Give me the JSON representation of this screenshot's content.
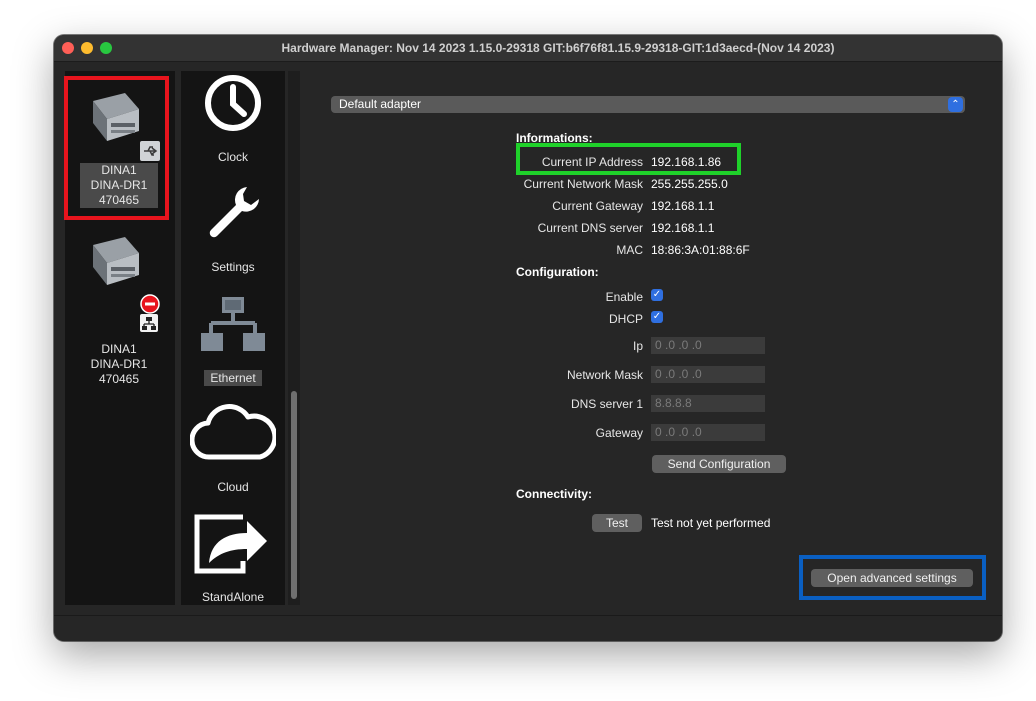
{
  "window": {
    "title": "Hardware Manager: Nov 14 2023 1.15.0-29318 GIT:b6f76f81.15.9-29318-GIT:1d3aecd-(Nov 14 2023)"
  },
  "devices": [
    {
      "name": "DINA1",
      "model": "DINA-DR1",
      "serial": "470465",
      "connection": "usb-icon",
      "selected": true
    },
    {
      "name": "DINA1",
      "model": "DINA-DR1",
      "serial": "470465",
      "connection": "network-icon",
      "status": "error-icon",
      "selected": false
    }
  ],
  "tabs": [
    {
      "label": "Clock",
      "icon": "clock-icon"
    },
    {
      "label": "Settings",
      "icon": "wrench-icon"
    },
    {
      "label": "Ethernet",
      "icon": "network-tree-icon",
      "selected": true
    },
    {
      "label": "Cloud",
      "icon": "cloud-icon"
    },
    {
      "label": "StandAlone",
      "icon": "share-arrow-icon"
    }
  ],
  "adapter": {
    "value": "Default adapter"
  },
  "informations": {
    "heading": "Informations:",
    "rows": [
      {
        "label": "Current IP Address",
        "value": "192.168.1.86"
      },
      {
        "label": "Current Network Mask",
        "value": "255.255.255.0"
      },
      {
        "label": "Current Gateway",
        "value": "192.168.1.1"
      },
      {
        "label": "Current DNS server",
        "value": "192.168.1.1"
      },
      {
        "label": "MAC",
        "value": "18:86:3A:01:88:6F"
      }
    ]
  },
  "configuration": {
    "heading": "Configuration:",
    "enable_label": "Enable",
    "enable_checked": true,
    "dhcp_label": "DHCP",
    "dhcp_checked": true,
    "ip_label": "Ip",
    "ip_value": "0 .0 .0 .0",
    "mask_label": "Network Mask",
    "mask_value": "0 .0 .0 .0",
    "dns_label": "DNS server 1",
    "dns_value": "8.8.8.8",
    "gateway_label": "Gateway",
    "gateway_value": "0 .0 .0 .0",
    "send_button": "Send Configuration"
  },
  "connectivity": {
    "heading": "Connectivity:",
    "test_button": "Test",
    "status": "Test not yet performed"
  },
  "advanced_button": "Open advanced settings",
  "colors": {
    "highlight_red": "#e8141d",
    "highlight_green": "#1fd12a",
    "highlight_blue": "#0a5fc2",
    "accent": "#2f6fe0"
  }
}
